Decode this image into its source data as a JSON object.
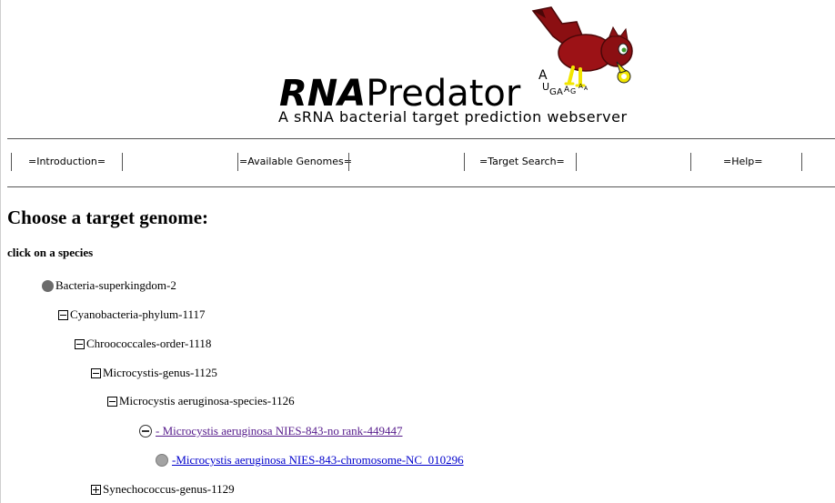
{
  "header": {
    "logo": {
      "wordmark_bold": "RNA",
      "wordmark_rest": "Predator",
      "tagline": "A sRNA bacterial target prediction webserver",
      "sequence_letters": [
        "A",
        "U",
        "G",
        "A",
        "A",
        "G",
        "A",
        "A"
      ]
    },
    "colors": {
      "bird_body": "#8b0f12",
      "bird_dark": "#4a0708",
      "beak": "#f2e600"
    }
  },
  "nav": {
    "items": [
      {
        "label": "=Introduction="
      },
      {
        "label": "=Available Genomes="
      },
      {
        "label": "=Target Search="
      },
      {
        "label": "=Help="
      }
    ]
  },
  "main": {
    "title": "Choose a target genome:",
    "subtitle": "click on a species",
    "tree": [
      {
        "label": "Bacteria-superkingdom-2",
        "icon": "gray-dot",
        "link": false
      },
      {
        "label": "Cyanobacteria-phylum-1117",
        "icon": "collapse-box",
        "link": false
      },
      {
        "label": "Chroococcales-order-1118",
        "icon": "collapse-box",
        "link": false
      },
      {
        "label": "Microcystis-genus-1125",
        "icon": "collapse-box",
        "link": false
      },
      {
        "label": "Microcystis aeruginosa-species-1126",
        "icon": "collapse-box",
        "link": false
      },
      {
        "label": "- Microcystis aeruginosa NIES-843-no rank-449447",
        "icon": "minus-circle",
        "link": true,
        "visited": true
      },
      {
        "label": "-Microcystis aeruginosa NIES-843-chromosome-NC_010296",
        "icon": "gray-dot",
        "link": true,
        "visited": false
      },
      {
        "label": "Synechococcus-genus-1129",
        "icon": "expand-box",
        "link": false
      }
    ],
    "colors": {
      "visited_link": "#551a8b",
      "link": "#0000cc"
    }
  }
}
